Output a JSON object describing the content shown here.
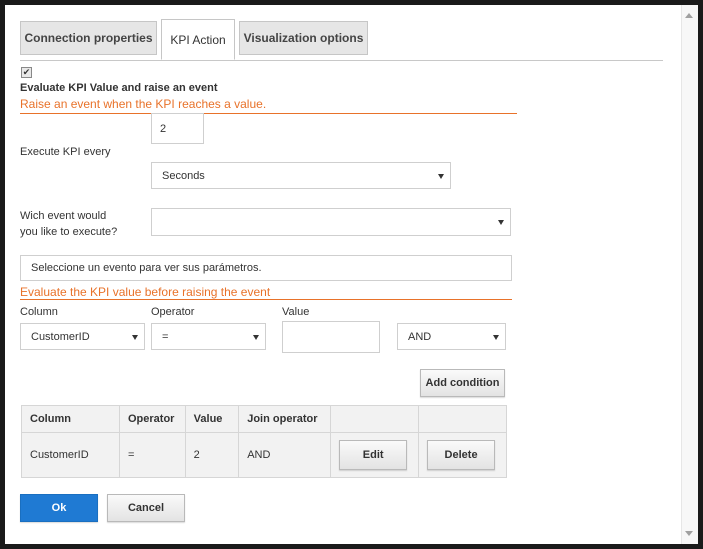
{
  "tabs": [
    {
      "label": "Connection properties"
    },
    {
      "label": "KPI Action"
    },
    {
      "label": "Visualization options"
    }
  ],
  "evaluate": {
    "checked": true,
    "checkbox_glyph": "✔",
    "label": "Evaluate KPI Value and raise an event"
  },
  "raise_section": {
    "title": "Raise an event when the KPI reaches a value.",
    "execute_label": "Execute KPI every",
    "interval_value": "2",
    "unit_selected": "Seconds",
    "event_label": "Wich event would you like to execute?",
    "event_selected": "",
    "params_text": "Seleccione un evento para ver sus parámetros."
  },
  "condition_section": {
    "title": "Evaluate the KPI value before raising the event",
    "column_label": "Column",
    "operator_label": "Operator",
    "value_label": "Value",
    "column_selected": "CustomerID",
    "operator_selected": "=",
    "value_input": "",
    "join_selected": "AND",
    "add_button": "Add condition"
  },
  "conditions_table": {
    "headers": [
      "Column",
      "Operator",
      "Value",
      "Join operator",
      "",
      ""
    ],
    "rows": [
      {
        "column": "CustomerID",
        "operator": "=",
        "value": "2",
        "join": "AND",
        "edit": "Edit",
        "delete": "Delete"
      }
    ]
  },
  "footer": {
    "ok": "Ok",
    "cancel": "Cancel"
  },
  "colors": {
    "accent_orange": "#e8722a",
    "primary_blue": "#1f7ad3"
  }
}
